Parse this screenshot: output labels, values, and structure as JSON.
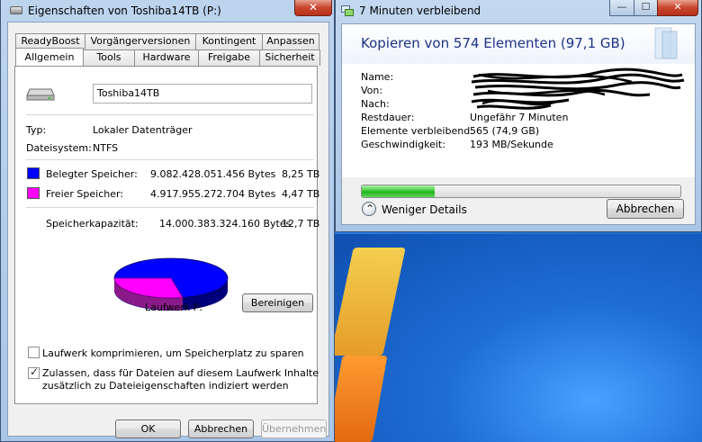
{
  "left_window": {
    "title": "Eigenschaften von Toshiba14TB (P:)",
    "close": "✕",
    "tabs_row1": [
      "ReadyBoost",
      "Vorgängerversionen",
      "Kontingent",
      "Anpassen"
    ],
    "tabs_row2": [
      "Allgemein",
      "Tools",
      "Hardware",
      "Freigabe",
      "Sicherheit"
    ],
    "active_tab": "Allgemein",
    "drive_name": "Toshiba14TB",
    "type_label": "Typ:",
    "type_value": "Lokaler Datenträger",
    "fs_label": "Dateisystem:",
    "fs_value": "NTFS",
    "used_label": "Belegter Speicher:",
    "used_bytes": "9.082.428.051.456 Bytes",
    "used_tb": "8,25 TB",
    "used_color": "#0000ff",
    "free_label": "Freier Speicher:",
    "free_bytes": "4.917.955.272.704 Bytes",
    "free_tb": "4,47 TB",
    "free_color": "#ff00ff",
    "capacity_label": "Speicherkapazität:",
    "capacity_bytes": "14.000.383.324.160 Bytes",
    "capacity_tb": "12,7 TB",
    "drive_label": "Laufwerk P:",
    "cleanup_button": "Bereinigen",
    "compress_checkbox": "Laufwerk komprimieren, um Speicherplatz zu sparen",
    "compress_checked": false,
    "index_checkbox_line1": "Zulassen, dass für Dateien auf diesem Laufwerk Inhalte",
    "index_checkbox_line2": "zusätzlich zu Dateieigenschaften indiziert werden",
    "index_checked": true,
    "ok_button": "OK",
    "cancel_button": "Abbrechen",
    "apply_button": "Übernehmen"
  },
  "right_window": {
    "title": "7 Minuten verbleibend",
    "minimize": "—",
    "maximize": "☐",
    "close": "✕",
    "heading": "Kopieren von 574 Elementen (97,1 GB)",
    "name_label": "Name:",
    "from_label": "Von:",
    "to_label": "Nach:",
    "remaining_label": "Restdauer:",
    "remaining_value": "Ungefähr 7 Minuten",
    "items_label": "Elemente verbleibend:",
    "items_value": "565 (74,9 GB)",
    "speed_label": "Geschwindigkeit:",
    "speed_value": "193 MB/Sekunde",
    "progress_fraction": 0.23,
    "details_toggle": "Weniger Details",
    "cancel_button": "Abbrechen"
  }
}
